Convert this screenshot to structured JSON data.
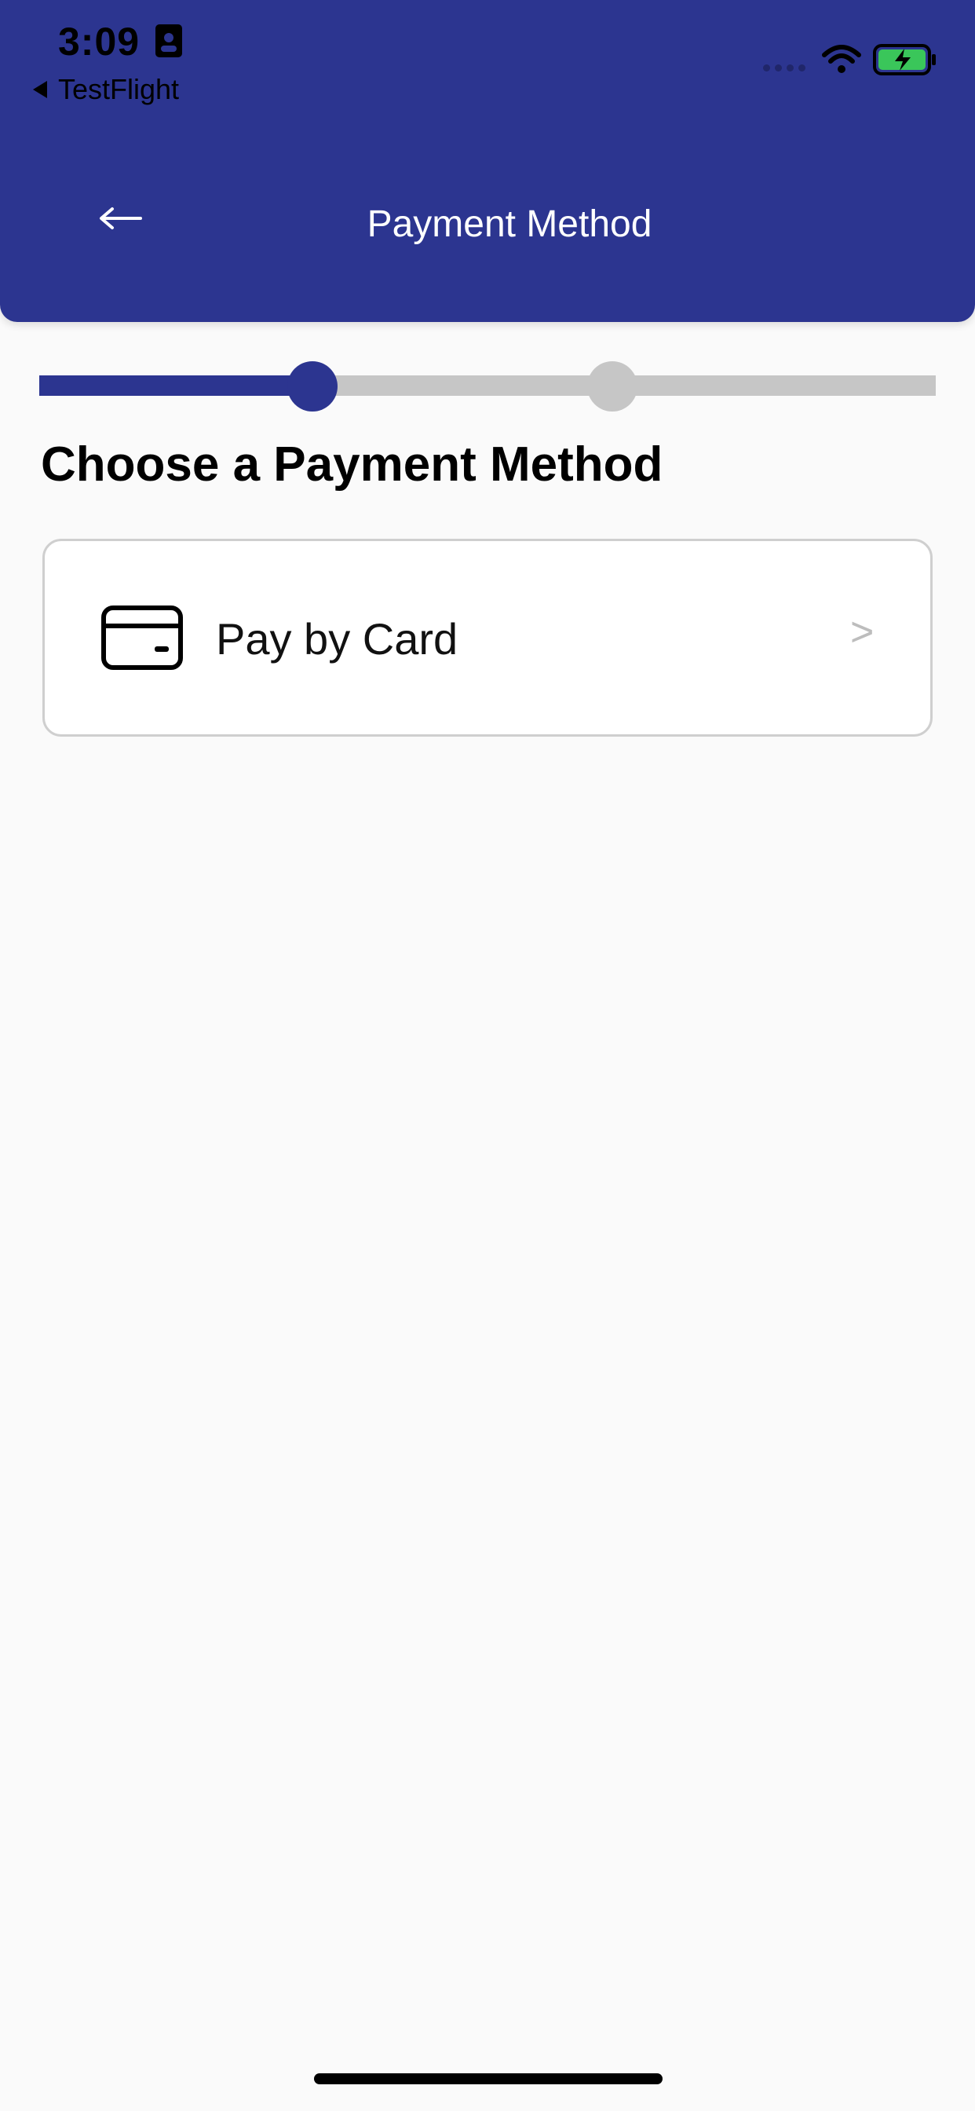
{
  "status_bar": {
    "time": "3:09",
    "back_app": "TestFlight"
  },
  "header": {
    "title": "Payment Method",
    "color": "#2c3590"
  },
  "stepper": {
    "current_step": 1,
    "total_steps": 2
  },
  "main": {
    "heading": "Choose a Payment Method",
    "options": [
      {
        "label": "Pay by Card",
        "icon": "credit-card-icon",
        "chevron": ">"
      }
    ]
  }
}
